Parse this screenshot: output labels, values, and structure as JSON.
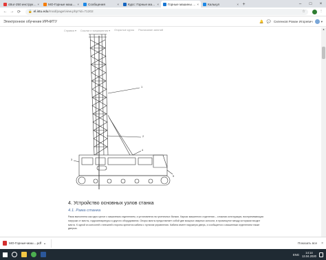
{
  "browser": {
    "tabs": [
      {
        "title": "cBur-250 инструкция - Яндекс",
        "color": "#e53935",
        "active": false
      },
      {
        "title": "МО-Горные машины",
        "color": "#f57c00",
        "active": false
      },
      {
        "title": "Сообщения",
        "color": "#1e88e5",
        "active": false
      },
      {
        "title": "Курс: Горные машины",
        "color": "#1565c0",
        "active": false
      },
      {
        "title": "Горные машины и оборудование",
        "color": "#1976d2",
        "active": true
      },
      {
        "title": "Калькул",
        "color": "#1e88e5",
        "active": false
      }
    ],
    "tab_close_glyph": "×",
    "new_tab_glyph": "+",
    "window_controls": [
      "–",
      "□",
      "×"
    ],
    "nav": {
      "back": "←",
      "forward": "→",
      "reload": "⟳"
    },
    "address": {
      "lock": "🔒",
      "host": "el.istu.edu",
      "path": "/mod/page/view.php?id=71202",
      "bookmark_star": "☆"
    },
    "toolbar_menu": "⋮"
  },
  "moodle": {
    "site_name": "Электронное обучение ИРНИТУ",
    "user_name": "Силенков Роман Игоревич",
    "user_caret": "▾",
    "bell": "🔔",
    "chat": "💬",
    "nav_items": [
      "Справка ▾",
      "Ссылки и предприятия ▾",
      "Открытые курсы",
      "Расписание занятий"
    ]
  },
  "content": {
    "drawing_labels": [
      "1",
      "2",
      "3",
      "4",
      "5"
    ],
    "section_heading": "4. Устройство основных узлов станка",
    "subsection_heading": "4.1. Рама станка",
    "body_text": "Рама выполнена как одно целое с машинным отделением, и установлена на гусеничных балках. Каркас машинного отделения – сложная конструкция, воспринимающая нагрузки от мачты, гидроаппаратуры и другого оборудования. Опоры мачты представляет собой две мощных сварных консоли, в промежутке между которыми входит мачта. К одной из консолей с внешней стороны крепится кабина с пультом управления. Кабина имеет наружную дверь, и сообщается с машинным отделением также дверью."
  },
  "scrollbar": {
    "up": "▲",
    "down": "▼"
  },
  "download": {
    "file_name": "МО-Горные-маш....pdf",
    "caret": "▴",
    "show_all": "Показать все",
    "close": "×"
  },
  "taskbar": {
    "apps": [
      {
        "name": "search",
        "color": "#ffffff"
      },
      {
        "name": "explorer",
        "color": "#f2c744"
      },
      {
        "name": "chrome",
        "color": "#4caf50"
      },
      {
        "name": "word",
        "color": "#2b579a"
      }
    ],
    "lang": "ENG",
    "time": "14:14",
    "date": "13.04.2020"
  }
}
